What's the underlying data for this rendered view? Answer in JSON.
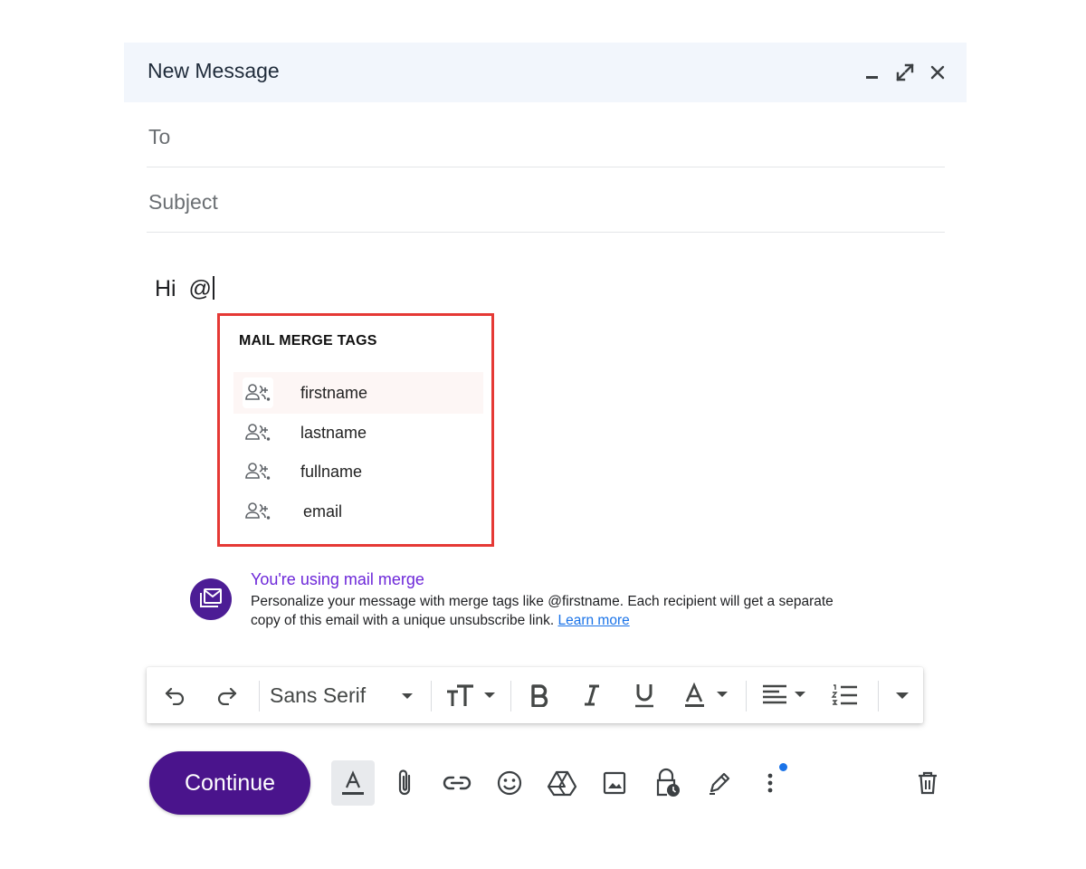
{
  "header": {
    "title": "New Message"
  },
  "fields": {
    "to_placeholder": "To",
    "subject_placeholder": "Subject"
  },
  "body": {
    "text": "Hi  @"
  },
  "merge_popup": {
    "title": "MAIL MERGE TAGS",
    "items": [
      {
        "label": "firstname",
        "icon": "person-add-icon"
      },
      {
        "label": "lastname",
        "icon": "person-add-icon"
      },
      {
        "label": "fullname",
        "icon": "person-add-icon"
      },
      {
        "label": "email",
        "icon": "person-add-icon"
      }
    ]
  },
  "banner": {
    "title": "You're using mail merge",
    "text": "Personalize your message with merge tags like @firstname. Each recipient will get a separate copy of this email with a unique unsubscribe link. ",
    "link": "Learn more",
    "icon": "mail-merge-icon"
  },
  "toolbar": {
    "font": "Sans Serif"
  },
  "bottom": {
    "continue_label": "Continue"
  },
  "colors": {
    "header_bg": "#f2f6fc",
    "accent_purple": "#4a148c",
    "popup_border": "#e53935",
    "link": "#1a73e8"
  }
}
